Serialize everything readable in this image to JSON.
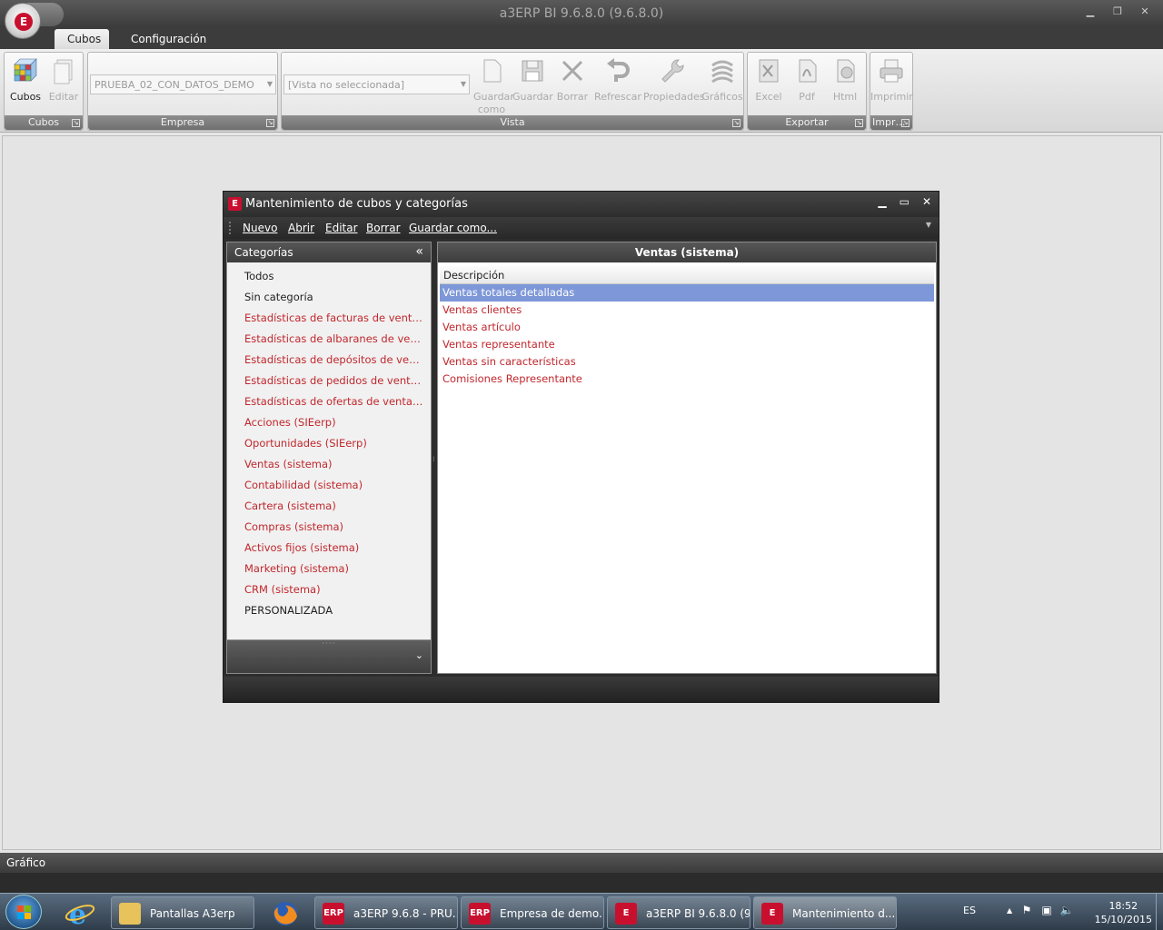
{
  "window": {
    "title": "a3ERP BI 9.6.8.0 (9.6.8.0)",
    "app_icon": "E",
    "controls": [
      "minimize",
      "restore",
      "close"
    ]
  },
  "ribbon_tabs": [
    {
      "label": "Cubos",
      "active": true
    },
    {
      "label": "Configuración",
      "active": false
    }
  ],
  "ribbon": {
    "groups": {
      "cubos": {
        "label": "Cubos",
        "buttons": [
          {
            "label": "Cubos",
            "icon": "cube-grid-icon",
            "enabled": true
          },
          {
            "label": "Editar",
            "icon": "edit-document-icon",
            "enabled": false
          }
        ]
      },
      "empresa": {
        "label": "Empresa",
        "combo_value": "PRUEBA_02_CON_DATOS_DEMO"
      },
      "vista": {
        "label": "Vista",
        "combo_value": "[Vista no seleccionada]",
        "buttons": [
          {
            "label": "Guardar como",
            "icon": "document-icon",
            "enabled": false
          },
          {
            "label": "Guardar",
            "icon": "floppy-icon",
            "enabled": false
          },
          {
            "label": "Borrar",
            "icon": "x-icon",
            "enabled": false
          },
          {
            "label": "Refrescar",
            "icon": "undo-icon",
            "enabled": false
          },
          {
            "label": "Propiedades",
            "icon": "wrench-icon",
            "enabled": false
          },
          {
            "label": "Gráficos",
            "icon": "stack-icon",
            "enabled": false
          }
        ]
      },
      "exportar": {
        "label": "Exportar",
        "buttons": [
          {
            "label": "Excel",
            "icon": "excel-icon",
            "enabled": false
          },
          {
            "label": "Pdf",
            "icon": "pdf-icon",
            "enabled": false
          },
          {
            "label": "Html",
            "icon": "html-icon",
            "enabled": false
          }
        ]
      },
      "imprimir": {
        "label": "Impr…",
        "buttons": [
          {
            "label": "Imprimir",
            "icon": "printer-icon",
            "enabled": false
          }
        ]
      }
    }
  },
  "dialog": {
    "title": "Mantenimiento de cubos y categorías",
    "menu": [
      "Nuevo",
      "Abrir",
      "Editar",
      "Borrar",
      "Guardar como..."
    ],
    "categories_header": "Categorías",
    "categories": [
      {
        "label": "Todos",
        "color": "#222222"
      },
      {
        "label": "Sin categoría",
        "color": "#222222"
      },
      {
        "label": "Estadísticas de facturas de venta (SIEerp)",
        "color": "#c1272d"
      },
      {
        "label": "Estadísticas de albaranes de venta (SIEerp)",
        "color": "#c1272d"
      },
      {
        "label": "Estadísticas de depósitos de venta (SIEerp)",
        "color": "#c1272d"
      },
      {
        "label": "Estadísticas de pedidos de venta (SIEerp)",
        "color": "#c1272d"
      },
      {
        "label": "Estadísticas de ofertas de venta (SIEerp)",
        "color": "#c1272d"
      },
      {
        "label": "Acciones (SIEerp)",
        "color": "#c1272d"
      },
      {
        "label": "Oportunidades (SIEerp)",
        "color": "#c1272d"
      },
      {
        "label": "Ventas (sistema)",
        "color": "#c1272d"
      },
      {
        "label": "Contabilidad (sistema)",
        "color": "#c1272d"
      },
      {
        "label": "Cartera (sistema)",
        "color": "#c1272d"
      },
      {
        "label": "Compras (sistema)",
        "color": "#c1272d"
      },
      {
        "label": "Activos fijos (sistema)",
        "color": "#c1272d"
      },
      {
        "label": "Marketing (sistema)",
        "color": "#c1272d"
      },
      {
        "label": "CRM (sistema)",
        "color": "#c1272d"
      },
      {
        "label": "PERSONALIZADA",
        "color": "#222222"
      }
    ],
    "cubes_header": "Ventas (sistema)",
    "grid_column": "Descripción",
    "cubes": [
      {
        "label": "Ventas totales detalladas",
        "selected": true
      },
      {
        "label": "Ventas clientes",
        "selected": false
      },
      {
        "label": "Ventas artículo",
        "selected": false
      },
      {
        "label": "Ventas representante",
        "selected": false
      },
      {
        "label": "Ventas sin características",
        "selected": false
      },
      {
        "label": "Comisiones Representante",
        "selected": false
      }
    ]
  },
  "grafico_panel": {
    "label": "Gráfico"
  },
  "taskbar": {
    "items": [
      {
        "label": "Pantallas A3erp",
        "icon": "folder-icon"
      },
      {
        "label": "a3ERP 9.6.8 - PRU...",
        "icon": "erp-icon"
      },
      {
        "label": "Empresa de demo...",
        "icon": "erp-icon"
      },
      {
        "label": "a3ERP BI 9.6.8.0 (9...",
        "icon": "bi-icon"
      },
      {
        "label": "Mantenimiento d...",
        "icon": "bi-icon"
      }
    ],
    "language": "ES",
    "time": "18:52",
    "date": "15/10/2015"
  },
  "colors": {
    "accent_red": "#c8102e",
    "category_red": "#c1272d",
    "selection_blue": "#7d97d8"
  }
}
